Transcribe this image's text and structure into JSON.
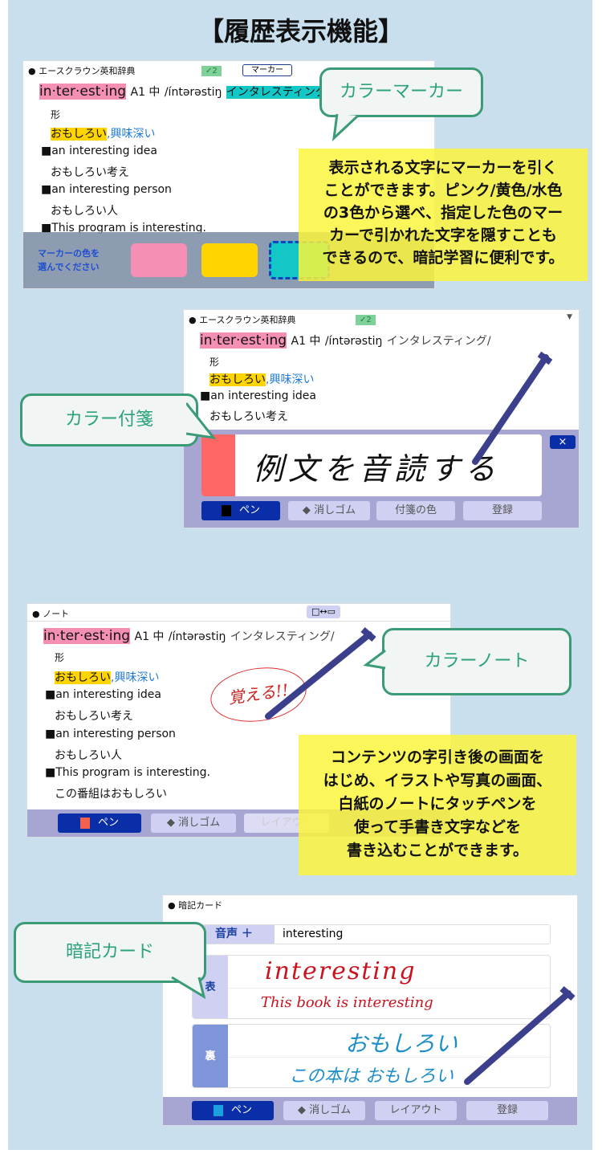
{
  "title": "【履歴表示機能】",
  "entry": {
    "headword": "in·ter·est·ing",
    "marks": "A1 中",
    "pron": "/íntərəstiŋ",
    "kana": "インタレスティング/",
    "pos": "形",
    "meaning1": "おもしろい",
    "meaning2": ",興味深い",
    "ex1": "■an interesting idea",
    "ex1ja": "おもしろい考え",
    "ex2": "■an interesting person",
    "ex2ja": "おもしろい人",
    "ex3": "■This program is interesting.",
    "ex3ja": "この番組はおもしろい"
  },
  "marker": {
    "dict_name": "● エースクラウン英和辞典",
    "check": "✓2",
    "marker_button": "マーカー",
    "prompt": "マーカーの色を\n選んでください",
    "swatches": [
      "#f58fb4",
      "#ffd400",
      "#13c7c7"
    ],
    "callout": "カラーマーカー",
    "description": "表示される文字にマーカーを引く\nことができます。ピンク/黄色/水色\nの3色から選べ、指定した色のマー\nカーで引かれた文字を隠すことも\nできるので、暗記学習に便利です。"
  },
  "sticky": {
    "dict_name": "● エースクラウン英和辞典",
    "check": "✓2",
    "dropdown_icon": "▼",
    "handwriting": "例文を音読する",
    "close": "×",
    "buttons": {
      "pen": "ペン",
      "eraser": "消しゴム",
      "color": "付箋の色",
      "register": "登録"
    },
    "note_color": "#ff6666",
    "callout": "カラー付箋"
  },
  "note": {
    "header": "● ノート",
    "layout_toggle": "□↔▭",
    "annotation": "覚える!!",
    "buttons": {
      "pen": "ペン",
      "eraser": "消しゴム",
      "layout": "レイアウト"
    },
    "callout": "カラーノート",
    "description": "コンテンツの字引き後の画面を\nはじめ、イラストや写真の画面、\n白紙のノートにタッチペンを\n使って手書き文字などを\n書き込むことができます。"
  },
  "card": {
    "header": "● 暗記カード",
    "audio": "音声 ＋",
    "word": "interesting",
    "front_label": "表",
    "back_label": "裏",
    "front1": "interesting",
    "front2": "This book is interesting",
    "back1": "おもしろい",
    "back2": "この本は おもしろい",
    "buttons": {
      "pen": "ペン",
      "eraser": "消しゴム",
      "layout": "レイアウト",
      "register": "登録"
    },
    "callout": "暗記カード"
  }
}
